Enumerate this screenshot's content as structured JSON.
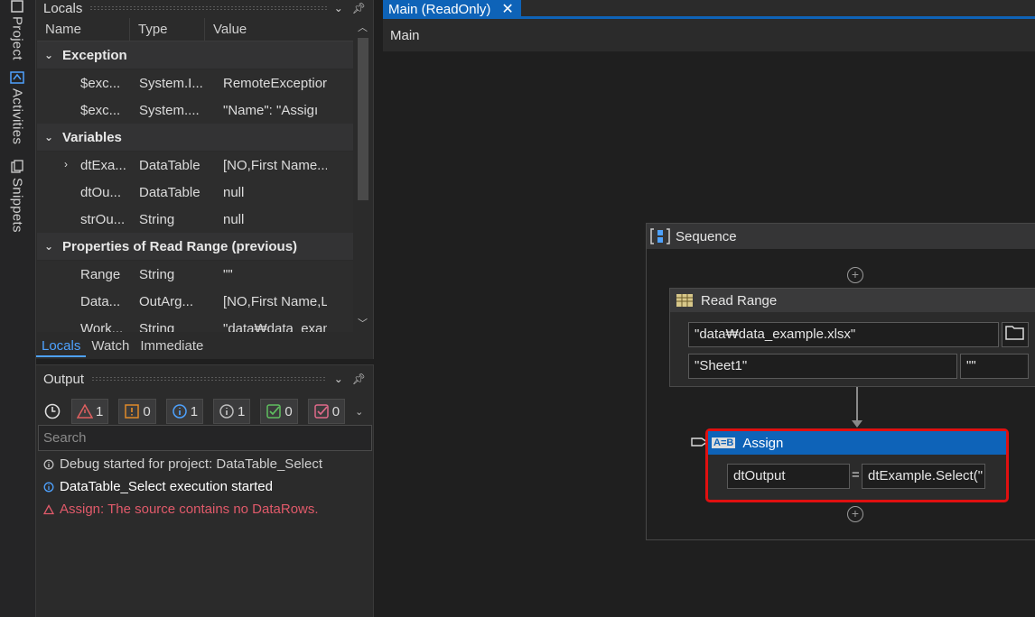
{
  "rail": {
    "items": [
      {
        "label": "Project"
      },
      {
        "label": "Activities"
      },
      {
        "label": "Snippets"
      }
    ]
  },
  "locals": {
    "title": "Locals",
    "columns": [
      "Name",
      "Type",
      "Value"
    ],
    "groups": [
      {
        "label": "Exception",
        "rows": [
          {
            "name": "$exc...",
            "type": "System.I...",
            "value": "RemoteExceptior"
          },
          {
            "name": "$exc...",
            "type": "System....",
            "value": "  \"Name\": \"Assigı"
          }
        ]
      },
      {
        "label": "Variables",
        "rows": [
          {
            "name": "dtExa...",
            "type": "DataTable",
            "value": "[NO,First Name..."
          },
          {
            "name": "dtOu...",
            "type": "DataTable",
            "value": "null"
          },
          {
            "name": "strOu...",
            "type": "String",
            "value": "null"
          }
        ]
      },
      {
        "label": "Properties of Read Range (previous)",
        "rows": [
          {
            "name": "Range",
            "type": "String",
            "value": "\"\""
          },
          {
            "name": "Data...",
            "type": "OutArg...",
            "value": "[NO,First Name,L"
          },
          {
            "name": "Work...",
            "type": "String",
            "value": "\"data₩data_exam"
          }
        ]
      }
    ],
    "tabs": [
      "Locals",
      "Watch",
      "Immediate"
    ],
    "active_tab": "Locals"
  },
  "output": {
    "title": "Output",
    "filters": [
      {
        "icon": "warning-icon",
        "count": "1",
        "color": "#e06060"
      },
      {
        "icon": "error-icon",
        "count": "0",
        "color": "#e08a2a"
      },
      {
        "icon": "info-icon",
        "count": "1",
        "color": "#4ea2ff"
      },
      {
        "icon": "trace-icon",
        "count": "1",
        "color": "#bdbdbd"
      },
      {
        "icon": "success-icon",
        "count": "0",
        "color": "#5fbf5f"
      },
      {
        "icon": "verify-icon",
        "count": "0",
        "color": "#e06a8a"
      }
    ],
    "search_placeholder": "Search",
    "logs": [
      {
        "icon": "trace-icon",
        "text": "Debug started for project: DataTable_Select",
        "color": "#cfcfcf"
      },
      {
        "icon": "info-icon",
        "text": "DataTable_Select execution started",
        "color": "#ffffff"
      },
      {
        "icon": "warning-icon",
        "text": "Assign: The source contains no DataRows.",
        "color": "#e05a6a"
      }
    ]
  },
  "document": {
    "tab_label": "Main (ReadOnly)",
    "breadcrumb": "Main"
  },
  "workflow": {
    "sequence_label": "Sequence",
    "read_range": {
      "title": "Read Range",
      "path": "\"data₩data_example.xlsx\"",
      "sheet": "\"Sheet1\"",
      "range": "\"\""
    },
    "assign": {
      "title": "Assign",
      "to": "dtOutput",
      "equals": "=",
      "value": "dtExample.Select(\""
    }
  },
  "colors": {
    "accent": "#0e63b8",
    "highlight_border": "#e01010"
  }
}
